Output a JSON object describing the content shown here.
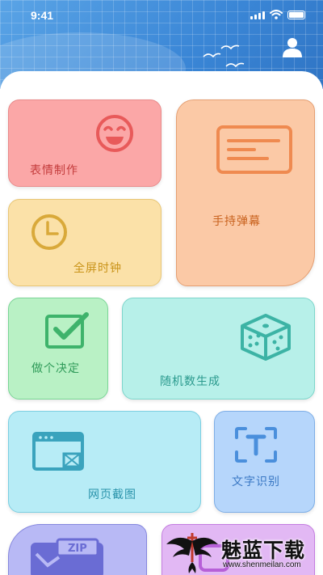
{
  "status_bar": {
    "time": "9:41"
  },
  "cards": {
    "face": {
      "label": "表情制作",
      "icon": "smiley-face-icon",
      "color": "#fba7a7"
    },
    "clock": {
      "label": "全屏时钟",
      "icon": "clock-icon",
      "color": "#fbe1a8"
    },
    "barrage": {
      "label": "手持弹幕",
      "icon": "barrage-screen-icon",
      "color": "#fbc9a6"
    },
    "decide": {
      "label": "做个决定",
      "icon": "checkbox-icon",
      "color": "#b9f1c5"
    },
    "random": {
      "label": "随机数生成",
      "icon": "dice-icon",
      "color": "#b7f0e9"
    },
    "web": {
      "label": "网页截图",
      "icon": "web-screenshot-icon",
      "color": "#b7ecf6"
    },
    "ocr": {
      "label": "文字识别",
      "icon": "text-recognition-icon",
      "color": "#b6d6fb"
    },
    "zip": {
      "icon": "zip-file-icon",
      "color": "#b8b9f5"
    },
    "purple": {
      "icon": "app-icon",
      "color": "#e2b8f4"
    }
  },
  "watermark": {
    "name": "魅蓝下载",
    "url": "www.shenmeilan.com"
  }
}
